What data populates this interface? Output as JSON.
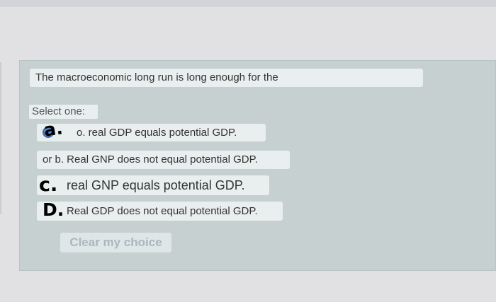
{
  "question": {
    "text": "The macroeconomic long run is long enough for the",
    "select_label": "Select one:"
  },
  "options": [
    {
      "text": "o. real GDP equals potential GDP.",
      "selected": true
    },
    {
      "text": "or b. Real GNP does not equal potential GDP.",
      "selected": false
    },
    {
      "text": "real GNP equals potential GDP.",
      "selected": false
    },
    {
      "text": "Real GDP does not equal potential GDP.",
      "selected": false
    }
  ],
  "handwritten": {
    "a": "a.",
    "c": "c.",
    "d": "D."
  },
  "clear_label": "Clear my choice",
  "colors": {
    "panel": "#c6d0d1",
    "option_bg": "#e9eeef",
    "radio_selected": "#5b86c2",
    "clear_text": "#a9b7bf"
  }
}
